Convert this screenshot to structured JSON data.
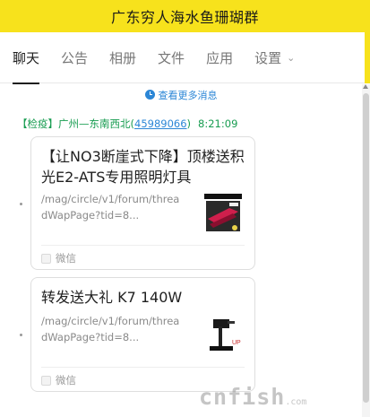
{
  "window": {
    "title": "广东穷人海水鱼珊瑚群"
  },
  "tabs": [
    {
      "label": "聊天",
      "active": true
    },
    {
      "label": "公告"
    },
    {
      "label": "相册"
    },
    {
      "label": "文件"
    },
    {
      "label": "应用"
    },
    {
      "label": "设置",
      "has_dropdown": true,
      "chevron_icon": "chevron-down-icon"
    }
  ],
  "chat": {
    "load_more": {
      "label": "查看更多消息",
      "icon": "clock-icon"
    },
    "message": {
      "sender_prefix": "【检疫】广州—东南西北(",
      "sender_qq": "45989066",
      "sender_suffix": ")",
      "time": "8:21:09"
    },
    "cards": [
      {
        "title": "【让NO3断崖式下降】顶楼送积光E2-ATS专用照明灯具",
        "url": "/mag/circle/v1/forum/threadWapPage?tid=8...",
        "source": "微信",
        "thumb_icon": "product-thumbnail"
      },
      {
        "title": "转发送大礼 K7 140W",
        "url": "/mag/circle/v1/forum/threadWapPage?tid=8...",
        "source": "微信",
        "thumb_icon": "lamp-thumbnail"
      }
    ]
  },
  "watermark": {
    "text": "cnfish",
    "suffix": ".com"
  },
  "colors": {
    "titlebar": "#f7e21c",
    "link_blue": "#2b86d6",
    "sender_green": "#179c50"
  }
}
